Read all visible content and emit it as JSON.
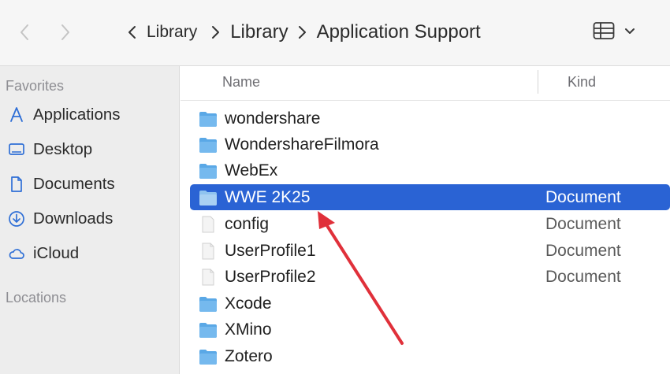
{
  "toolbar": {
    "path": {
      "first": "Library",
      "middle": "Library",
      "current": "Application Support"
    }
  },
  "sidebar": {
    "favorites_heading": "Favorites",
    "items": [
      {
        "label": "Applications",
        "icon": "applications-icon"
      },
      {
        "label": "Desktop",
        "icon": "desktop-icon"
      },
      {
        "label": "Documents",
        "icon": "document-icon"
      },
      {
        "label": "Downloads",
        "icon": "downloads-icon"
      },
      {
        "label": "iCloud",
        "icon": "icloud-icon"
      }
    ],
    "locations_heading": "Locations"
  },
  "list": {
    "columns": {
      "name": "Name",
      "kind": "Kind"
    },
    "rows": [
      {
        "name": "wondershare",
        "kind": "",
        "type": "folder"
      },
      {
        "name": "WondershareFilmora",
        "kind": "",
        "type": "folder"
      },
      {
        "name": "WebEx",
        "kind": "",
        "type": "folder"
      },
      {
        "name": "WWE 2K25",
        "kind": "Document",
        "type": "folder",
        "selected": true
      },
      {
        "name": "config",
        "kind": "Document",
        "type": "file"
      },
      {
        "name": "UserProfile1",
        "kind": "Document",
        "type": "file"
      },
      {
        "name": "UserProfile2",
        "kind": "Document",
        "type": "file"
      },
      {
        "name": "Xcode",
        "kind": "",
        "type": "folder"
      },
      {
        "name": "XMino",
        "kind": "",
        "type": "folder"
      },
      {
        "name": "Zotero",
        "kind": "",
        "type": "folder"
      }
    ]
  },
  "colors": {
    "selection": "#2a63d4",
    "folder": "#5aa8e6",
    "accent_icon": "#2f6fd6",
    "annotation_arrow": "#e0303a"
  }
}
